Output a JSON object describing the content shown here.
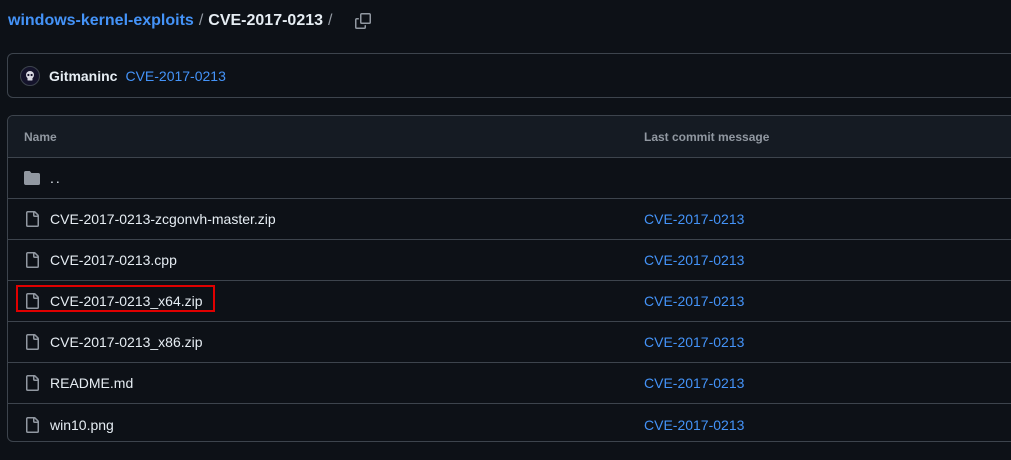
{
  "breadcrumb": {
    "repo": "windows-kernel-exploits",
    "separator": "/",
    "current": "CVE-2017-0213",
    "trailing_separator": "/"
  },
  "latest_commit": {
    "author": "Gitmaninc",
    "message": "CVE-2017-0213"
  },
  "table": {
    "headers": {
      "name": "Name",
      "last_commit": "Last commit message"
    },
    "parent_label": "..",
    "rows": [
      {
        "name": "CVE-2017-0213-zcgonvh-master.zip",
        "commit": "CVE-2017-0213",
        "icon": "file-icon"
      },
      {
        "name": "CVE-2017-0213.cpp",
        "commit": "CVE-2017-0213",
        "icon": "file-icon"
      },
      {
        "name": "CVE-2017-0213_x64.zip",
        "commit": "CVE-2017-0213",
        "icon": "file-icon",
        "highlighted": true
      },
      {
        "name": "CVE-2017-0213_x86.zip",
        "commit": "CVE-2017-0213",
        "icon": "file-icon"
      },
      {
        "name": "README.md",
        "commit": "CVE-2017-0213",
        "icon": "file-icon"
      },
      {
        "name": "win10.png",
        "commit": "CVE-2017-0213",
        "icon": "file-icon"
      }
    ]
  },
  "colors": {
    "background": "#0d1117",
    "link": "#4493f8",
    "text": "#e6edf3",
    "muted": "#9198a1",
    "border": "#3d444d",
    "highlight": "#e00000"
  }
}
